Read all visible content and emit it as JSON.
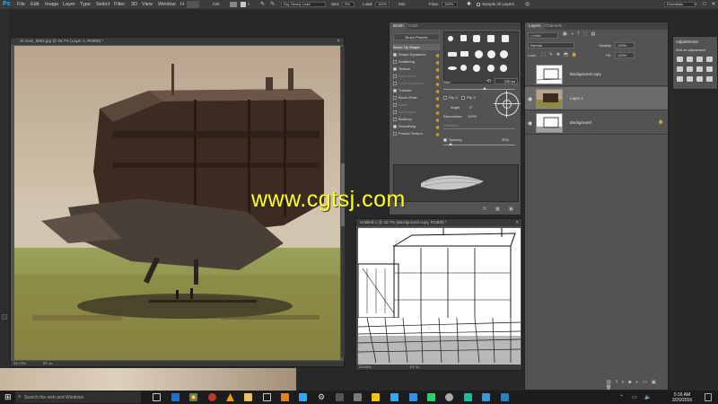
{
  "app": {
    "logo": "Ps"
  },
  "menu": [
    "File",
    "Edit",
    "Image",
    "Layer",
    "Type",
    "Select",
    "Filter",
    "3D",
    "View",
    "Window",
    "H"
  ],
  "options": {
    "brush_size": "230",
    "preset": "Dry, Heavy Load",
    "wet_label": "Wet:",
    "wet_value": "0%",
    "load_label": "Load:",
    "load_value": "100%",
    "mix_label": "Mix:",
    "flow_label": "Flow:",
    "flow_value": "100%",
    "sample_label": "Sample All Layers",
    "workspace": "Essentials"
  },
  "doc1": {
    "title": "ck scan_0004.jpg @ 28.7% (Layer 1, RGB/8) *",
    "zoom": "28.72%",
    "status": "Ef: 1x"
  },
  "doc2": {
    "title": "Untitled-1 @ 33.7% (Background copy, RGB/8) *",
    "zoom": "33.68%",
    "status": "Ef: 1x"
  },
  "brush": {
    "tabs": [
      "Brush",
      "Color"
    ],
    "presets_button": "Brush Presets",
    "items": [
      {
        "label": "Brush Tip Shape",
        "checked": false,
        "highlight": true
      },
      {
        "label": "Shape Dynamics",
        "checked": true
      },
      {
        "label": "Scattering",
        "checked": false
      },
      {
        "label": "Texture",
        "checked": true
      },
      {
        "label": "Dual Brush",
        "checked": false
      },
      {
        "label": "Color Dynamics",
        "checked": false
      },
      {
        "label": "Transfer",
        "checked": true
      },
      {
        "label": "Brush Pose",
        "checked": false
      },
      {
        "label": "Noise",
        "checked": false
      },
      {
        "label": "Wet Edges",
        "checked": false
      },
      {
        "label": "Build-up",
        "checked": false
      },
      {
        "label": "Smoothing",
        "checked": true
      },
      {
        "label": "Protect Texture",
        "checked": false
      }
    ],
    "size_label": "Size",
    "size_value": "230 px",
    "flip_x": "Flip X",
    "flip_y": "Flip Y",
    "angle_label": "Angle:",
    "angle_value": "0°",
    "roundness_label": "Roundness:",
    "roundness_value": "100%",
    "hardness_label": "Hardness",
    "spacing_label": "Spacing",
    "spacing_value": "30%"
  },
  "layers": {
    "tabs": [
      "Layers",
      "Channels"
    ],
    "kind": "Kind",
    "mode": "Normal",
    "opacity_label": "Opacity:",
    "opacity_value": "100%",
    "lock_label": "Lock:",
    "fill_label": "Fill:",
    "fill_value": "100%",
    "items": [
      {
        "name": "Background copy",
        "selected": false
      },
      {
        "name": "Layer 1",
        "selected": true
      },
      {
        "name": "Background",
        "selected": false
      }
    ]
  },
  "adjustments": {
    "title": "Adjustments",
    "subtitle": "Add an adjustment"
  },
  "watermark": "www.cgtsj.com",
  "taskbar": {
    "search_placeholder": "Search the web and Windows",
    "time": "5:16 AM",
    "date": "3/20/2016"
  },
  "colors": {
    "accent": "#31a8ff",
    "panel": "#535353",
    "watermark": "#ffff22"
  }
}
